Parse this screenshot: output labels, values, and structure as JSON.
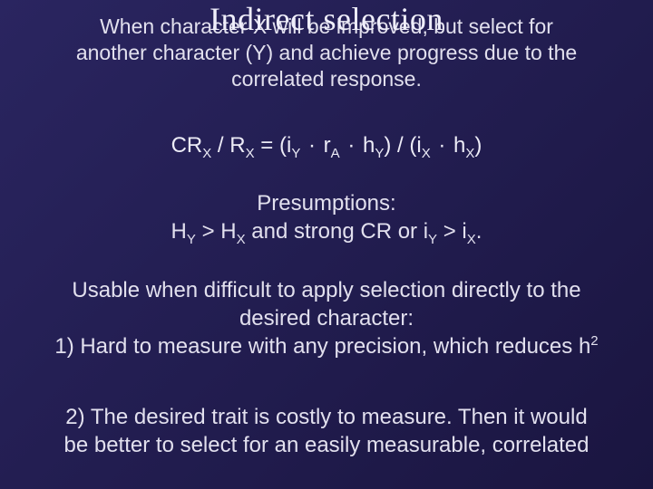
{
  "title": "Indirect selection",
  "intro_line1": "When  character X will be improved, but select for",
  "intro_line2": "another character (Y) and achieve progress due to the",
  "intro_line3": "correlated response.",
  "formula": {
    "lhs1": "CR",
    "lhs1_sub": "X",
    "slash": " / ",
    "lhs2": "R",
    "lhs2_sub": "X",
    "eq": " = (i",
    "iy_sub": "Y",
    "dot1": " · ",
    "ra": "r",
    "ra_sub": "A",
    "dot2": " ·  ",
    "hy": "h",
    "hy_sub": "Y",
    "mid": ") / (i",
    "ix_sub": "X",
    "dot3": " · ",
    "hx": "h",
    "hx_sub": "X",
    "end": ")"
  },
  "presumptions": {
    "label": "Presumptions:",
    "hy": "H",
    "hy_sub": "Y",
    "gt": " > ",
    "hx": "H",
    "hx_sub": "X",
    "and": " and strong CR or i",
    "iy_sub": "Y",
    "gt2": " > i",
    "ix_sub": "X",
    "period": "."
  },
  "usable": {
    "line1": "Usable when difficult to apply selection directly to the",
    "line2": "desired character:",
    "p1a": "1) Hard to measure with any precision, which reduces h",
    "p1_sup": "2"
  },
  "point2": {
    "l1": "2) The desired trait is costly to measure. Then it would",
    "l2": "be better to select for an easily measurable, correlated"
  }
}
